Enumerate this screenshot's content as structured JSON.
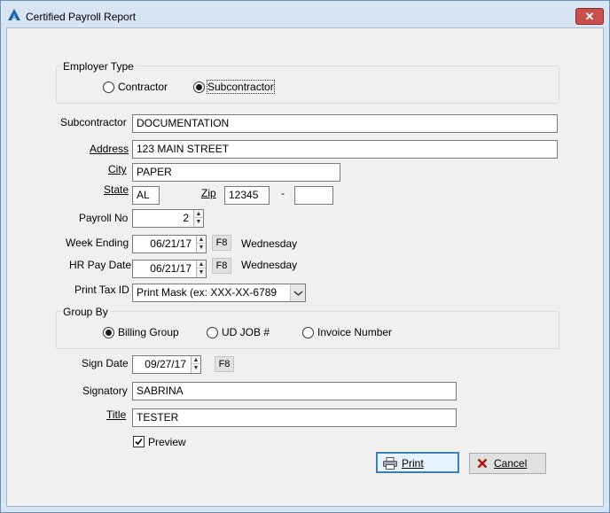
{
  "window": {
    "title": "Certified Payroll Report",
    "close_glyph": "✕"
  },
  "employer_type": {
    "label": "Employer Type",
    "options": [
      {
        "label": "Contractor",
        "checked": false
      },
      {
        "label": "Subcontractor",
        "checked": true
      }
    ]
  },
  "fields": {
    "subcontractor": {
      "label": "Subcontractor",
      "value": "DOCUMENTATION"
    },
    "address": {
      "label": "Address",
      "value": "123 MAIN STREET"
    },
    "city": {
      "label": "City",
      "value": "PAPER"
    },
    "state": {
      "label": "State",
      "value": "AL"
    },
    "zip": {
      "label": "Zip",
      "value": "12345",
      "separator": "-",
      "ext_value": ""
    },
    "payroll_no": {
      "label": "Payroll No",
      "value": "2"
    },
    "week_ending": {
      "label": "Week Ending",
      "value": "06/21/17",
      "key": "F8",
      "day": "Wednesday"
    },
    "hr_pay_date": {
      "label": "HR Pay Date",
      "value": "06/21/17",
      "key": "F8",
      "day": "Wednesday"
    },
    "print_tax_id": {
      "label": "Print Tax ID",
      "value": "Print Mask (ex: XXX-XX-6789"
    }
  },
  "group_by": {
    "label": "Group By",
    "options": [
      {
        "label": "Billing Group",
        "checked": true
      },
      {
        "label": "UD JOB #",
        "checked": false
      },
      {
        "label": "Invoice Number",
        "checked": false
      }
    ]
  },
  "sign": {
    "sign_date": {
      "label": "Sign Date",
      "value": "09/27/17",
      "key": "F8"
    },
    "signatory": {
      "label": "Signatory",
      "value": "SABRINA"
    },
    "title": {
      "label": "Title",
      "value": "TESTER"
    },
    "preview": {
      "label": "Preview",
      "checked": true
    }
  },
  "buttons": {
    "print": "Print",
    "cancel": "Cancel"
  },
  "colors": {
    "window_frame": "#d7e4f2",
    "close_button": "#c7504c",
    "default_button_border": "#3c7fb1"
  }
}
